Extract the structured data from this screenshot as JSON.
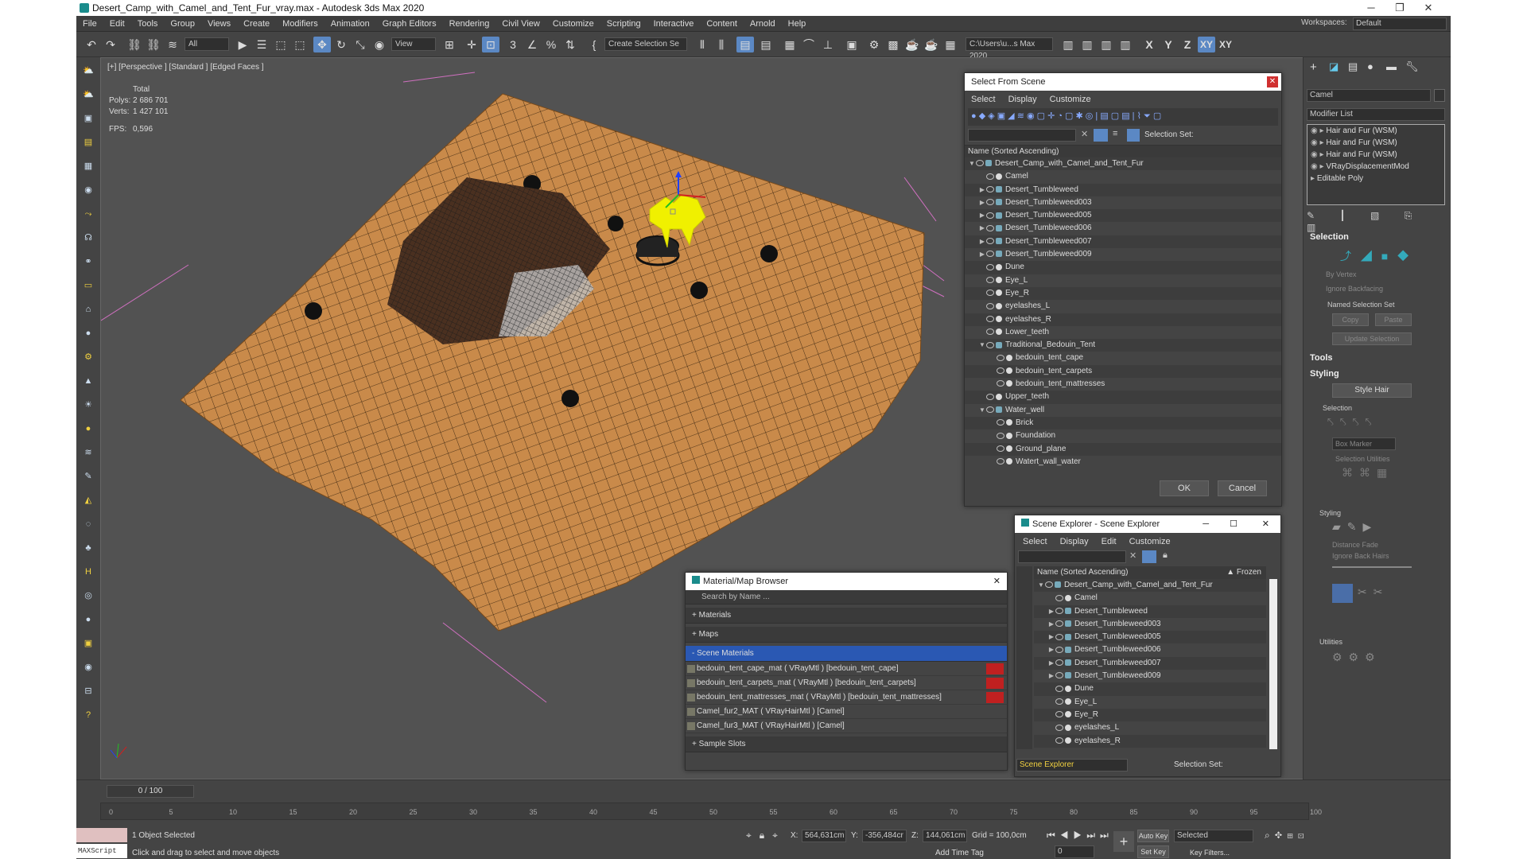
{
  "window": {
    "title": "Desert_Camp_with_Camel_and_Tent_Fur_vray.max - Autodesk 3ds Max 2020",
    "min": "─",
    "max": "❐",
    "close": "✕"
  },
  "menu": [
    "File",
    "Edit",
    "Tools",
    "Group",
    "Views",
    "Create",
    "Modifiers",
    "Animation",
    "Graph Editors",
    "Rendering",
    "Civil View",
    "Customize",
    "Scripting",
    "Interactive",
    "Content",
    "Arnold",
    "Help"
  ],
  "workspace": {
    "label": "Workspaces:",
    "value": "Default"
  },
  "toolbar": {
    "filter": "All",
    "refcoord": "View",
    "selset": "Create Selection Se",
    "path": "C:\\Users\\u...s Max 2020",
    "axis": [
      "X",
      "Y",
      "Z",
      "XY",
      "XY"
    ]
  },
  "viewport": {
    "label": "[+] [Perspective ] [Standard ] [Edged Faces ]",
    "stats_total": "Total",
    "polys_label": "Polys:",
    "polys": "2 686 701",
    "verts_label": "Verts:",
    "verts": "1 427 101",
    "fps_label": "FPS:",
    "fps": "0,596"
  },
  "select_from_scene": {
    "title": "Select From Scene",
    "menu": [
      "Select",
      "Display",
      "Customize"
    ],
    "selset_label": "Selection Set:",
    "header": "Name (Sorted Ascending)",
    "ok": "OK",
    "cancel": "Cancel",
    "rows": [
      {
        "name": "Desert_Camp_with_Camel_and_Tent_Fur",
        "level": 0,
        "exp": "▼",
        "icon": true
      },
      {
        "name": "Camel",
        "level": 1,
        "exp": "",
        "icon": false
      },
      {
        "name": "Desert_Tumbleweed",
        "level": 1,
        "exp": "▶",
        "icon": true
      },
      {
        "name": "Desert_Tumbleweed003",
        "level": 1,
        "exp": "▶",
        "icon": true
      },
      {
        "name": "Desert_Tumbleweed005",
        "level": 1,
        "exp": "▶",
        "icon": true
      },
      {
        "name": "Desert_Tumbleweed006",
        "level": 1,
        "exp": "▶",
        "icon": true
      },
      {
        "name": "Desert_Tumbleweed007",
        "level": 1,
        "exp": "▶",
        "icon": true
      },
      {
        "name": "Desert_Tumbleweed009",
        "level": 1,
        "exp": "▶",
        "icon": true
      },
      {
        "name": "Dune",
        "level": 1,
        "exp": "",
        "icon": false
      },
      {
        "name": "Eye_L",
        "level": 1,
        "exp": "",
        "icon": false
      },
      {
        "name": "Eye_R",
        "level": 1,
        "exp": "",
        "icon": false
      },
      {
        "name": "eyelashes_L",
        "level": 1,
        "exp": "",
        "icon": false
      },
      {
        "name": "eyelashes_R",
        "level": 1,
        "exp": "",
        "icon": false
      },
      {
        "name": "Lower_teeth",
        "level": 1,
        "exp": "",
        "icon": false
      },
      {
        "name": "Traditional_Bedouin_Tent",
        "level": 1,
        "exp": "▼",
        "icon": true
      },
      {
        "name": "bedouin_tent_cape",
        "level": 2,
        "exp": "",
        "icon": false
      },
      {
        "name": "bedouin_tent_carpets",
        "level": 2,
        "exp": "",
        "icon": false
      },
      {
        "name": "bedouin_tent_mattresses",
        "level": 2,
        "exp": "",
        "icon": false
      },
      {
        "name": "Upper_teeth",
        "level": 1,
        "exp": "",
        "icon": false
      },
      {
        "name": "Water_well",
        "level": 1,
        "exp": "▼",
        "icon": true
      },
      {
        "name": "Brick",
        "level": 2,
        "exp": "",
        "icon": false
      },
      {
        "name": "Foundation",
        "level": 2,
        "exp": "",
        "icon": false
      },
      {
        "name": "Ground_plane",
        "level": 2,
        "exp": "",
        "icon": false
      },
      {
        "name": "Watert_wall_water",
        "level": 2,
        "exp": "",
        "icon": false
      }
    ]
  },
  "scene_explorer": {
    "title": "Scene Explorer - Scene Explorer",
    "menu": [
      "Select",
      "Display",
      "Edit",
      "Customize"
    ],
    "header": "Name (Sorted Ascending)",
    "frozen": "▲ Frozen",
    "footer_dd": "Scene Explorer",
    "selset_label": "Selection Set:",
    "rows": [
      {
        "name": "Desert_Camp_with_Camel_and_Tent_Fur",
        "level": 0,
        "exp": "▼",
        "icon": true
      },
      {
        "name": "Camel",
        "level": 1,
        "exp": "",
        "icon": false
      },
      {
        "name": "Desert_Tumbleweed",
        "level": 1,
        "exp": "▶",
        "icon": true
      },
      {
        "name": "Desert_Tumbleweed003",
        "level": 1,
        "exp": "▶",
        "icon": true
      },
      {
        "name": "Desert_Tumbleweed005",
        "level": 1,
        "exp": "▶",
        "icon": true
      },
      {
        "name": "Desert_Tumbleweed006",
        "level": 1,
        "exp": "▶",
        "icon": true
      },
      {
        "name": "Desert_Tumbleweed007",
        "level": 1,
        "exp": "▶",
        "icon": true
      },
      {
        "name": "Desert_Tumbleweed009",
        "level": 1,
        "exp": "▶",
        "icon": true
      },
      {
        "name": "Dune",
        "level": 1,
        "exp": "",
        "icon": false
      },
      {
        "name": "Eye_L",
        "level": 1,
        "exp": "",
        "icon": false
      },
      {
        "name": "Eye_R",
        "level": 1,
        "exp": "",
        "icon": false
      },
      {
        "name": "eyelashes_L",
        "level": 1,
        "exp": "",
        "icon": false
      },
      {
        "name": "eyelashes_R",
        "level": 1,
        "exp": "",
        "icon": false
      }
    ]
  },
  "material_browser": {
    "title": "Material/Map Browser",
    "search": "Search by Name ...",
    "cats": [
      "+ Materials",
      "+ Maps",
      "- Scene Materials"
    ],
    "sample": "+ Sample Slots",
    "items": [
      "bedouin_tent_cape_mat  ( VRayMtl ) [bedouin_tent_cape]",
      "bedouin_tent_carpets_mat  ( VRayMtl ) [bedouin_tent_carpets]",
      "bedouin_tent_mattresses_mat  ( VRayMtl ) [bedouin_tent_mattresses]",
      "Camel_fur2_MAT  ( VRayHairMtl ) [Camel]",
      "Camel_fur3_MAT  ( VRayHairMtl ) [Camel]"
    ]
  },
  "command_panel": {
    "object_name": "Camel",
    "modifier_list": "Modifier List",
    "stack": [
      "Hair and Fur (WSM)",
      "Hair and Fur (WSM)",
      "Hair and Fur (WSM)",
      "VRayDisplacementMod",
      "Editable Poly"
    ],
    "selection": "Selection",
    "by_vertex": "By Vertex",
    "ignore_backfacing": "Ignore Backfacing",
    "named_sel": "Named Selection Set",
    "copy": "Copy",
    "paste": "Paste",
    "update_sel": "Update Selection",
    "tools": "Tools",
    "styling": "Styling",
    "style_hair": "Style Hair",
    "sel_sub": "Selection",
    "box_marker": "Box Marker",
    "sel_util": "Selection Utilities",
    "styling_sub": "Styling",
    "distance_fade": "Distance Fade",
    "ignore_back_hairs": "Ignore Back Hairs",
    "utilities": "Utilities"
  },
  "timeline": {
    "frame": "0 / 100",
    "ticks": [
      "0",
      "5",
      "10",
      "15",
      "20",
      "25",
      "30",
      "35",
      "40",
      "45",
      "50",
      "55",
      "60",
      "65",
      "70",
      "75",
      "80",
      "85",
      "90",
      "95",
      "100"
    ]
  },
  "status": {
    "maxscript": "MAXScript Mi",
    "selected": "1 Object Selected",
    "prompt": "Click and drag to select and move objects",
    "x_label": "X:",
    "x": "564,631cm",
    "y_label": "Y:",
    "y": "-356,484cr",
    "z_label": "Z:",
    "z": "144,061cm",
    "grid": "Grid = 100,0cm",
    "add_time_tag": "Add Time Tag",
    "auto_key": "Auto Key",
    "set_key": "Set Key",
    "selected_dd": "Selected",
    "key_filters": "Key Filters...",
    "frame_field": "0"
  }
}
